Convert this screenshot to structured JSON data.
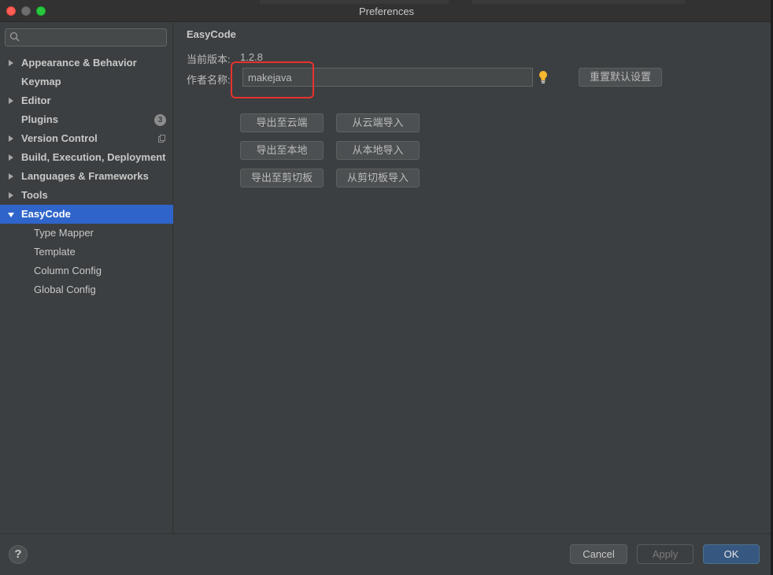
{
  "window": {
    "title": "Preferences"
  },
  "sidebar": {
    "search_placeholder": "",
    "items": [
      {
        "label": "Appearance & Behavior",
        "expandable": true
      },
      {
        "label": "Keymap",
        "expandable": false
      },
      {
        "label": "Editor",
        "expandable": true
      },
      {
        "label": "Plugins",
        "expandable": false,
        "badge": "3"
      },
      {
        "label": "Version Control",
        "expandable": true
      },
      {
        "label": "Build, Execution, Deployment",
        "expandable": true
      },
      {
        "label": "Languages & Frameworks",
        "expandable": true
      },
      {
        "label": "Tools",
        "expandable": true
      },
      {
        "label": "EasyCode",
        "expandable": true,
        "selected": true
      },
      {
        "label": "Type Mapper",
        "child": true
      },
      {
        "label": "Template",
        "child": true
      },
      {
        "label": "Column Config",
        "child": true
      },
      {
        "label": "Global Config",
        "child": true
      }
    ]
  },
  "main": {
    "title": "EasyCode",
    "version_label": "当前版本:",
    "version_value": "1.2.8",
    "author_label": "作者名称:",
    "author_value": "makejava",
    "reset_button": "重置默认设置",
    "buttons": [
      "导出至云端",
      "从云端导入",
      "导出至本地",
      "从本地导入",
      "导出至剪切板",
      "从剪切板导入"
    ]
  },
  "footer": {
    "help": "?",
    "cancel": "Cancel",
    "apply": "Apply",
    "ok": "OK"
  },
  "colors": {
    "selection": "#2f65ca",
    "highlight_box": "#e8322f",
    "ok_button": "#365880",
    "bulb": "#f5b82e"
  }
}
